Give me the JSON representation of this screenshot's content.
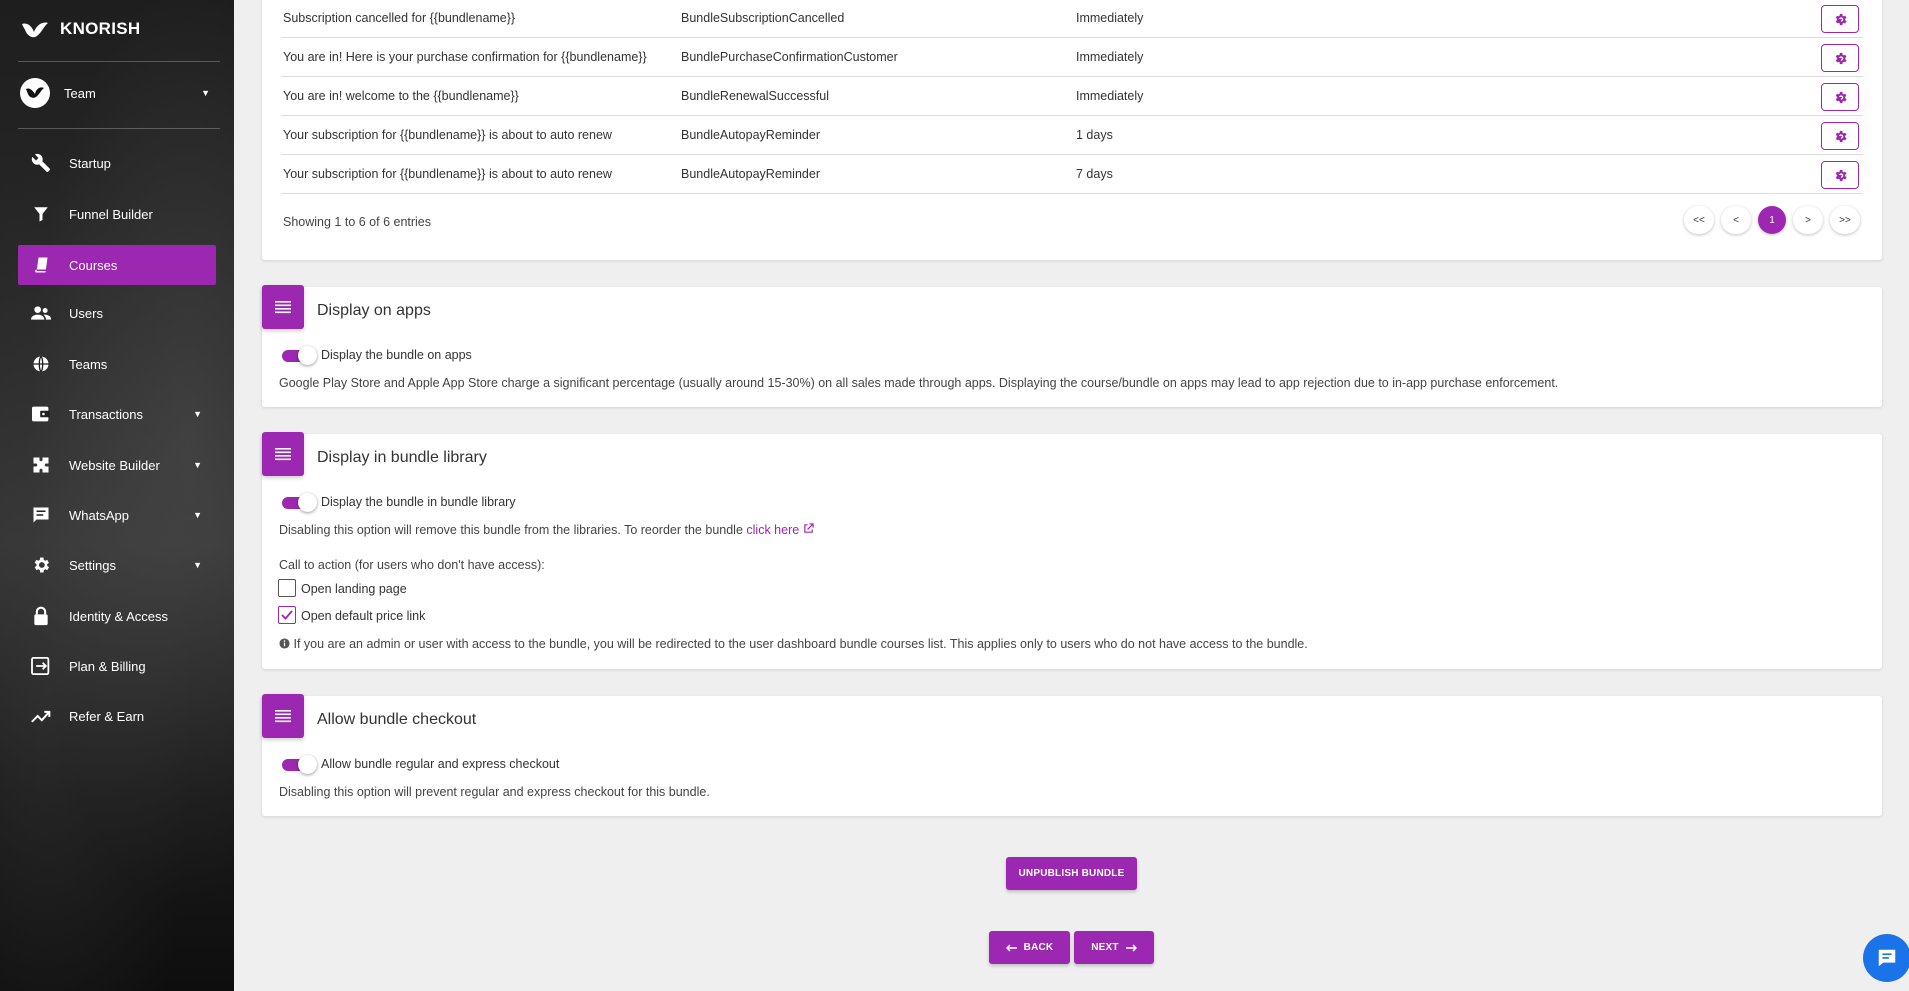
{
  "brand": {
    "name": "KNORISH"
  },
  "team": {
    "label": "Team",
    "avatar_text": "knorish"
  },
  "nav": [
    {
      "key": "startup",
      "label": "Startup",
      "icon": "wrench-icon",
      "caret": false,
      "active": false
    },
    {
      "key": "funnel-builder",
      "label": "Funnel Builder",
      "icon": "funnel-icon",
      "caret": false,
      "active": false
    },
    {
      "key": "courses",
      "label": "Courses",
      "icon": "book-icon",
      "caret": false,
      "active": true
    },
    {
      "key": "users",
      "label": "Users",
      "icon": "users-icon",
      "caret": false,
      "active": false
    },
    {
      "key": "teams",
      "label": "Teams",
      "icon": "globe-icon",
      "caret": false,
      "active": false
    },
    {
      "key": "transactions",
      "label": "Transactions",
      "icon": "wallet-icon",
      "caret": true,
      "active": false
    },
    {
      "key": "website-builder",
      "label": "Website Builder",
      "icon": "puzzle-icon",
      "caret": true,
      "active": false
    },
    {
      "key": "whatsapp",
      "label": "WhatsApp",
      "icon": "chat-icon",
      "caret": true,
      "active": false
    },
    {
      "key": "settings",
      "label": "Settings",
      "icon": "gear-icon",
      "caret": true,
      "active": false
    },
    {
      "key": "identity-access",
      "label": "Identity & Access",
      "icon": "lock-icon",
      "caret": false,
      "active": false
    },
    {
      "key": "plan-billing",
      "label": "Plan & Billing",
      "icon": "exit-icon",
      "caret": false,
      "active": false
    },
    {
      "key": "refer-earn",
      "label": "Refer & Earn",
      "icon": "trend-icon",
      "caret": false,
      "active": false
    }
  ],
  "notifications": {
    "rows": [
      {
        "subject": "Subscription cancelled for {{bundlename}}",
        "template": "BundleSubscriptionCancelled",
        "timing": "Immediately"
      },
      {
        "subject": "You are in! Here is your purchase confirmation for {{bundlename}}",
        "template": "BundlePurchaseConfirmationCustomer",
        "timing": "Immediately"
      },
      {
        "subject": "You are in! welcome to the {{bundlename}}",
        "template": "BundleRenewalSuccessful",
        "timing": "Immediately"
      },
      {
        "subject": "Your subscription for {{bundlename}} is about to auto renew",
        "template": "BundleAutopayReminder",
        "timing": "1 days"
      },
      {
        "subject": "Your subscription for {{bundlename}} is about to auto renew",
        "template": "BundleAutopayReminder",
        "timing": "7 days"
      }
    ],
    "showing": "Showing 1 to 6 of 6 entries",
    "pager": {
      "first": "<<",
      "prev": "<",
      "current": "1",
      "next": ">",
      "last": ">>"
    }
  },
  "display_apps": {
    "title": "Display on apps",
    "toggle_label": "Display the bundle on apps",
    "toggle_on": true,
    "note": "Google Play Store and Apple App Store charge a significant percentage (usually around 15-30%) on all sales made through apps. Displaying the course/bundle on apps may lead to app rejection due to in-app purchase enforcement."
  },
  "display_library": {
    "title": "Display in bundle library",
    "toggle_label": "Display the bundle in bundle library",
    "toggle_on": true,
    "note": "Disabling this option will remove this bundle from the libraries. To reorder the bundle",
    "link": "click here",
    "cta_label": "Call to action (for users who don't have access):",
    "options": [
      {
        "label": "Open landing page",
        "checked": false
      },
      {
        "label": "Open default price link",
        "checked": true
      }
    ],
    "info": "If you are an admin or user with access to the bundle, you will be redirected to the user dashboard bundle courses list. This applies only to users who do not have access to the bundle."
  },
  "checkout": {
    "title": "Allow bundle checkout",
    "toggle_label": "Allow bundle regular and express checkout",
    "toggle_on": true,
    "note": "Disabling this option will prevent regular and express checkout for this bundle."
  },
  "actions": {
    "unpublish": "UNPUBLISH BUNDLE",
    "back": "BACK",
    "next": "NEXT"
  },
  "colors": {
    "accent": "#9c27b0",
    "chat": "#1a73e8"
  }
}
